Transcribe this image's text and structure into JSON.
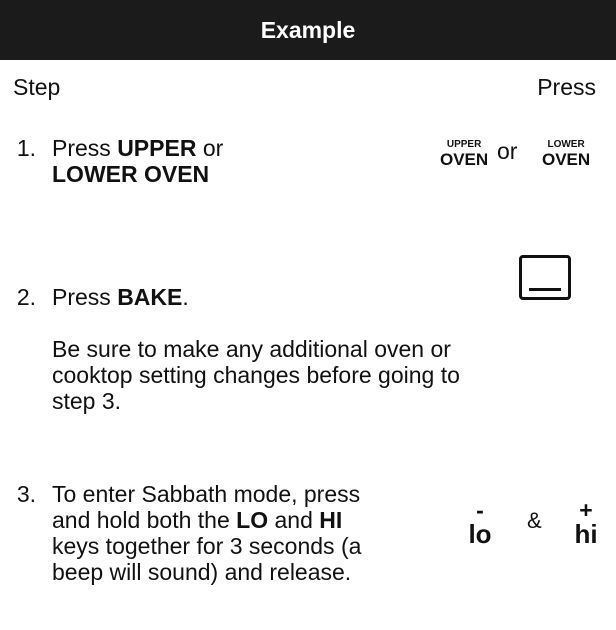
{
  "header": {
    "title": "Example"
  },
  "columns": {
    "step": "Step",
    "press": "Press"
  },
  "steps": [
    {
      "number": "1.",
      "text_pre": "Press ",
      "bold_a": "UPPER",
      "text_mid": " or",
      "bold_b": "LOWER OVEN"
    },
    {
      "number": "2.",
      "text_pre": "Press ",
      "bold_a": "BAKE",
      "text_post": ".",
      "note": "Be sure to make any additional oven or cooktop setting changes before going to step 3."
    },
    {
      "number": "3.",
      "line_a": "To enter Sabbath mode, press and hold both the ",
      "bold_a": "LO",
      "mid": " and ",
      "bold_b": "HI",
      "line_b": " keys together for 3 seconds (a beep will sound) and release."
    }
  ],
  "keys": {
    "upper_small": "UPPER",
    "upper_big": "OVEN",
    "or": "or",
    "lower_small": "LOWER",
    "lower_big": "OVEN",
    "bake_icon": "bake-button-icon",
    "lo_sign": "-",
    "lo_word": "lo",
    "amp": "&",
    "hi_sign": "+",
    "hi_word": "hi"
  }
}
